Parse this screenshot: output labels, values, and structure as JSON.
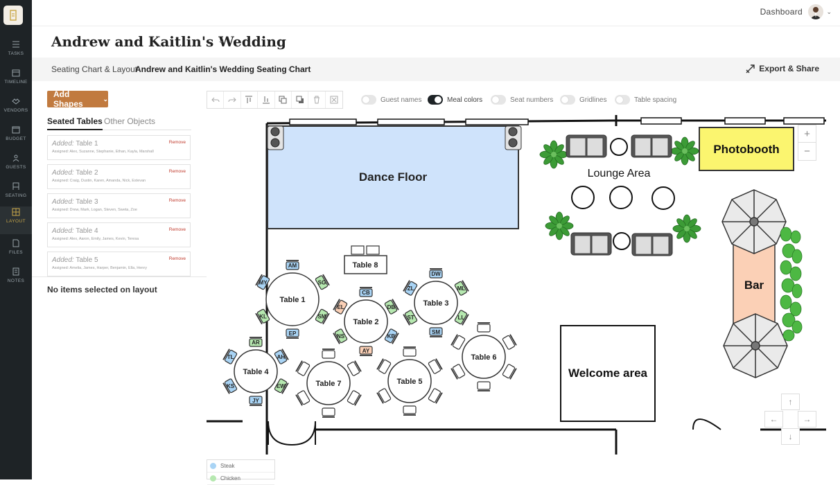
{
  "sidebar": {
    "items": [
      {
        "key": "tasks",
        "label": "TASKS",
        "icon": "checklist-icon"
      },
      {
        "key": "timeline",
        "label": "TIMELINE",
        "icon": "calendar-icon"
      },
      {
        "key": "vendors",
        "label": "VENDORS",
        "icon": "handshake-icon"
      },
      {
        "key": "budget",
        "label": "BUDGET",
        "icon": "wallet-icon"
      },
      {
        "key": "guests",
        "label": "GUESTS",
        "icon": "people-icon"
      },
      {
        "key": "seating",
        "label": "SEATING",
        "icon": "seating-icon"
      },
      {
        "key": "layout",
        "label": "LAYOUT",
        "icon": "layout-icon"
      },
      {
        "key": "files",
        "label": "FILES",
        "icon": "file-icon"
      },
      {
        "key": "notes",
        "label": "NOTES",
        "icon": "notes-icon"
      }
    ],
    "active": "layout"
  },
  "topbar": {
    "dashboard_label": "Dashboard"
  },
  "event": {
    "title": "Andrew and Kaitlin's Wedding"
  },
  "subbar": {
    "breadcrumb": "Seating Chart & Layout",
    "chart_name": "Andrew and Kaitlin's Wedding Seating Chart",
    "export_label": "Export & Share"
  },
  "left_panel": {
    "add_shapes_label": "Add Shapes",
    "tabs": [
      "Seated Tables",
      "Other Objects"
    ],
    "added_prefix": "Added:",
    "remove_label": "Remove",
    "tables": [
      {
        "name": "Table 1",
        "assigned": "Assigned: Alex, Suzanne, Stephanie, Ethan, Kayla, Marshall"
      },
      {
        "name": "Table 2",
        "assigned": "Assigned: Craig, Dustin, Karen, Amanda, Nick, Estevan"
      },
      {
        "name": "Table 3",
        "assigned": "Assigned: Drew, Mark, Logan, Steven, Sweta, Zoe"
      },
      {
        "name": "Table 4",
        "assigned": "Assigned: Alex, Aaron, Emily, James, Kevin, Teresa"
      },
      {
        "name": "Table 5",
        "assigned": "Assigned: Amelia, James, Harper, Benjamin, Ella, Henry"
      }
    ],
    "no_selection": "No items selected on layout"
  },
  "toggles": [
    {
      "label": "Guest names",
      "on": false
    },
    {
      "label": "Meal colors",
      "on": true
    },
    {
      "label": "Seat numbers",
      "on": false
    },
    {
      "label": "Gridlines",
      "on": false
    },
    {
      "label": "Table spacing",
      "on": false
    }
  ],
  "toolbar_icons": [
    "undo-icon",
    "redo-icon",
    "align-top-icon",
    "align-bottom-icon",
    "bring-forward-icon",
    "send-backward-icon",
    "trash-icon",
    "fit-icon"
  ],
  "floorplan": {
    "dance_floor": "Dance Floor",
    "photobooth": "Photobooth",
    "lounge": "Lounge Area",
    "bar": "Bar",
    "welcome": "Welcome area",
    "tables": [
      {
        "label": "Table 1",
        "seats": [
          "AM",
          "SG",
          "SM",
          "EP",
          "KL",
          "MY"
        ]
      },
      {
        "label": "Table 2",
        "seats": [
          "CB",
          "DB",
          "KB",
          "AY",
          "NS",
          "EL"
        ]
      },
      {
        "label": "Table 3",
        "seats": [
          "DW",
          "ML",
          "LL",
          "SM",
          "ST",
          "ZL"
        ]
      },
      {
        "label": "Table 4",
        "seats": [
          "AR",
          "AH",
          "EW",
          "JY",
          "KS",
          "TL"
        ]
      },
      {
        "label": "Table 5",
        "seats": []
      },
      {
        "label": "Table 6",
        "seats": []
      },
      {
        "label": "Table 7",
        "seats": []
      },
      {
        "label": "Table 8",
        "seats": []
      }
    ],
    "colors": {
      "steak": "#a9d4f5",
      "chicken": "#b6e8b0",
      "bar": "#fbd0b6",
      "photobooth": "#fbf56f",
      "dance": "#cfe3fb"
    }
  },
  "legend": [
    {
      "label": "Steak",
      "color": "#a9d4f5"
    },
    {
      "label": "Chicken",
      "color": "#b6e8b0"
    }
  ]
}
